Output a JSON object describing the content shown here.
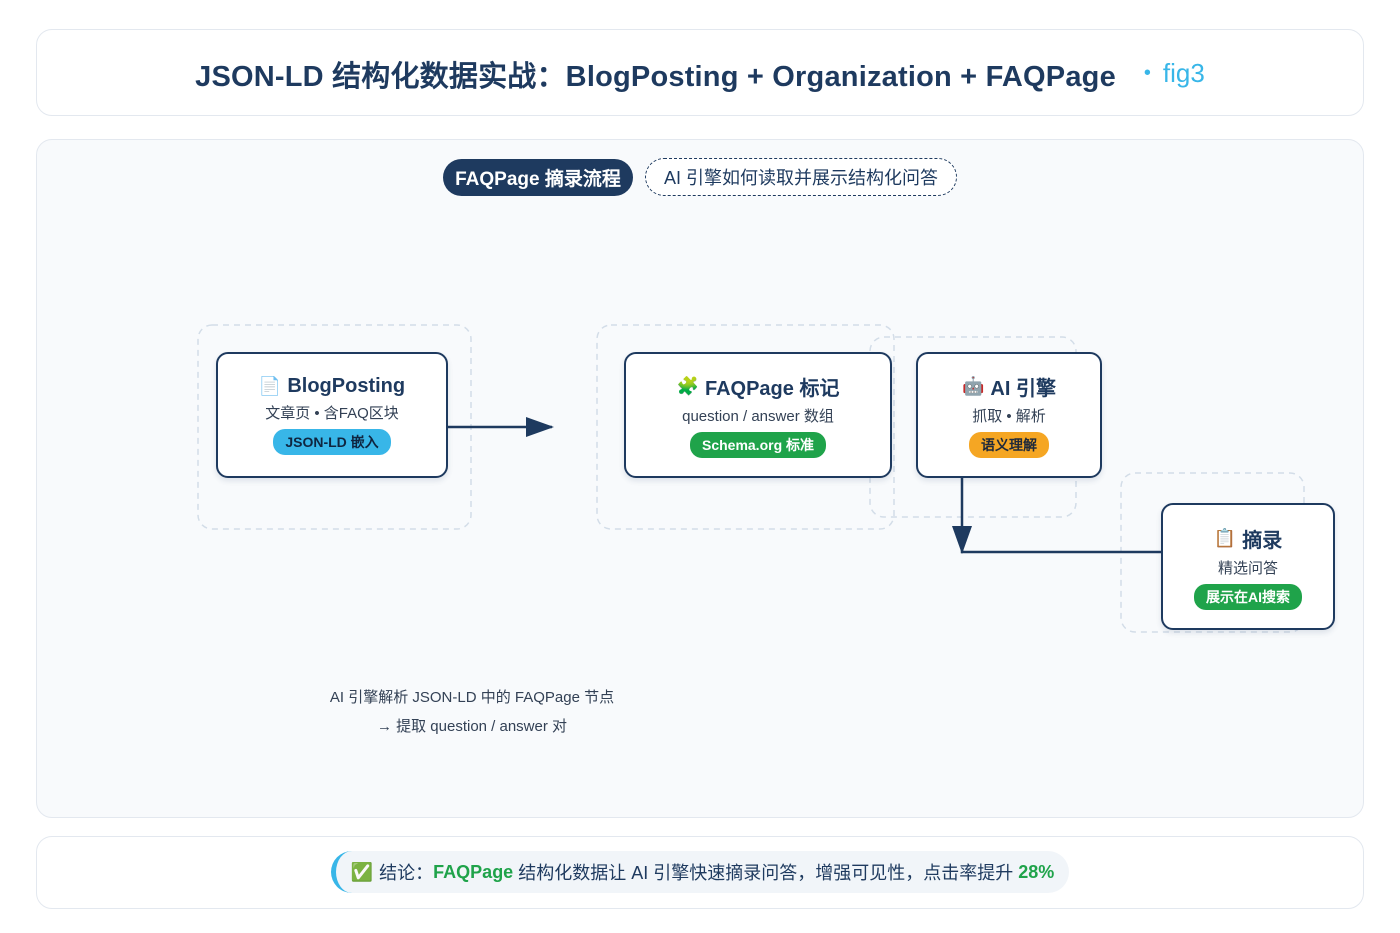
{
  "header": {
    "title": "JSON-LD 结构化数据实战：BlogPosting + Organization + FAQPage",
    "fig_tag": "fig3"
  },
  "panel": {
    "section_label": "FAQPage 摘录流程",
    "section_caption": "AI 引擎如何读取并展示结构化问答"
  },
  "nodes": [
    {
      "icon": "📄",
      "icon_name": "document-icon",
      "title": "BlogPosting",
      "subtitle": "文章页 • 含FAQ区块",
      "badge": "JSON-LD 嵌入",
      "badge_color": "#38b6e8"
    },
    {
      "icon": "🧩",
      "icon_name": "puzzle-icon",
      "title": "FAQPage 标记",
      "subtitle": "question / answer 数组",
      "badge": "Schema.org 标准",
      "badge_color": "#1fa34a"
    },
    {
      "icon": "🤖",
      "icon_name": "robot-icon",
      "title": "AI 引擎",
      "subtitle": "抓取 • 解析",
      "badge": "语义理解",
      "badge_color": "#f5a623"
    },
    {
      "icon": "📋",
      "icon_name": "clipboard-icon",
      "title": "摘录",
      "subtitle": "精选问答",
      "badge": "展示在AI搜索",
      "badge_color": "#1fa34a"
    }
  ],
  "notes": {
    "line1": "AI 引擎解析 JSON-LD 中的 FAQPage 节点",
    "line2": "→ 提取 question / answer 对"
  },
  "conclusion": {
    "icon": "✅",
    "prefix": "结论：",
    "highlight": "FAQPage",
    "body": " 结构化数据让 AI 引擎快速摘录问答，增强可见性，点击率提升 ",
    "stat": "28%"
  },
  "colors": {
    "primary": "#1e3a5f",
    "accent": "#38b6e8",
    "success": "#1fa34a",
    "warning": "#f5a623"
  }
}
